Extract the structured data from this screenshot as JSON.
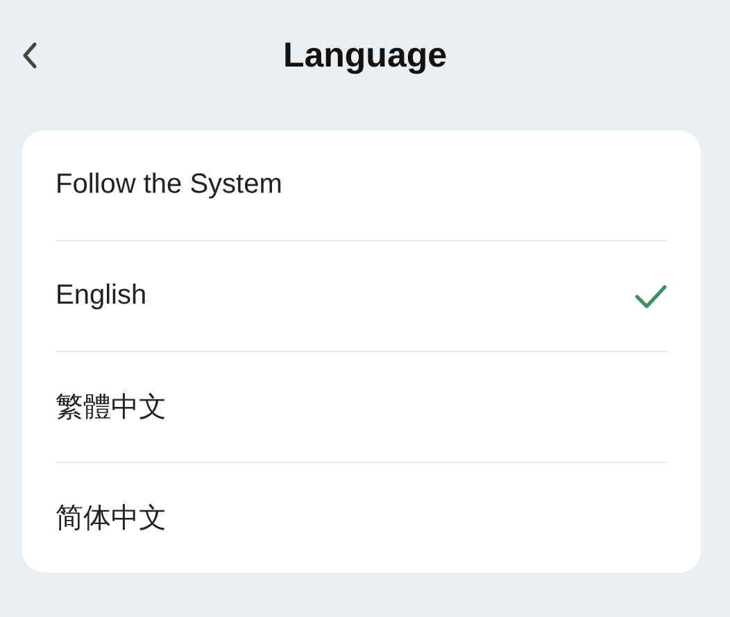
{
  "header": {
    "title": "Language"
  },
  "languages": [
    {
      "label": "Follow the System",
      "selected": false
    },
    {
      "label": "English",
      "selected": true
    },
    {
      "label": "繁體中文",
      "selected": false
    },
    {
      "label": "简体中文",
      "selected": false
    }
  ]
}
